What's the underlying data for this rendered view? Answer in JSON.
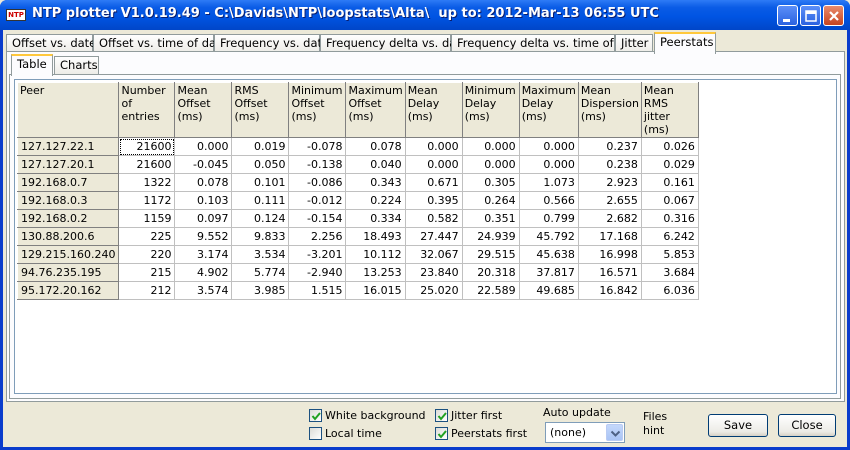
{
  "window": {
    "title": "NTP plotter V1.0.19.49 - C:\\Davids\\NTP\\loopstats\\Alta\\  up to: 2012-Mar-13 06:55 UTC",
    "icon_text": "NTP"
  },
  "tabs": [
    {
      "label": "Offset vs. date"
    },
    {
      "label": "Offset vs. time of day"
    },
    {
      "label": "Frequency vs. date"
    },
    {
      "label": "Frequency delta vs. date"
    },
    {
      "label": "Frequency delta vs. time of day"
    },
    {
      "label": "Jitter"
    },
    {
      "label": "Peerstats"
    }
  ],
  "subtabs": [
    {
      "label": "Table"
    },
    {
      "label": "Charts"
    }
  ],
  "table": {
    "headers": [
      "Peer",
      "Number of entries",
      "Mean Offset (ms)",
      "RMS Offset (ms)",
      "Minimum Offset (ms)",
      "Maximum Offset (ms)",
      "Mean Delay (ms)",
      "Minimum Delay (ms)",
      "Maximum Delay (ms)",
      "Mean Dispersion (ms)",
      "Mean RMS jitter (ms)"
    ],
    "rows": [
      [
        "127.127.22.1",
        "21600",
        "0.000",
        "0.019",
        "-0.078",
        "0.078",
        "0.000",
        "0.000",
        "0.000",
        "0.237",
        "0.026"
      ],
      [
        "127.127.20.1",
        "21600",
        "-0.045",
        "0.050",
        "-0.138",
        "0.040",
        "0.000",
        "0.000",
        "0.000",
        "0.238",
        "0.029"
      ],
      [
        "192.168.0.7",
        "1322",
        "0.078",
        "0.101",
        "-0.086",
        "0.343",
        "0.671",
        "0.305",
        "1.073",
        "2.923",
        "0.161"
      ],
      [
        "192.168.0.3",
        "1172",
        "0.103",
        "0.111",
        "-0.012",
        "0.224",
        "0.395",
        "0.264",
        "0.566",
        "2.655",
        "0.067"
      ],
      [
        "192.168.0.2",
        "1159",
        "0.097",
        "0.124",
        "-0.154",
        "0.334",
        "0.582",
        "0.351",
        "0.799",
        "2.682",
        "0.316"
      ],
      [
        "130.88.200.6",
        "225",
        "9.552",
        "9.833",
        "2.256",
        "18.493",
        "27.447",
        "24.939",
        "45.792",
        "17.168",
        "6.242"
      ],
      [
        "129.215.160.240",
        "220",
        "3.174",
        "3.534",
        "-3.201",
        "10.112",
        "32.067",
        "29.515",
        "45.638",
        "16.998",
        "5.853"
      ],
      [
        "94.76.235.195",
        "215",
        "4.902",
        "5.774",
        "-2.940",
        "13.253",
        "23.840",
        "20.318",
        "37.817",
        "16.571",
        "3.684"
      ],
      [
        "95.172.20.162",
        "212",
        "3.574",
        "3.985",
        "1.515",
        "16.015",
        "25.020",
        "22.589",
        "49.685",
        "16.842",
        "6.036"
      ]
    ]
  },
  "options": {
    "white_background": "White background",
    "local_time": "Local time",
    "jitter_first": "Jitter first",
    "peerstats_first": "Peerstats first",
    "auto_update_label": "Auto update",
    "auto_update_value": "(none)",
    "files_hint": "Files hint"
  },
  "buttons": {
    "save": "Save",
    "close": "Close"
  }
}
